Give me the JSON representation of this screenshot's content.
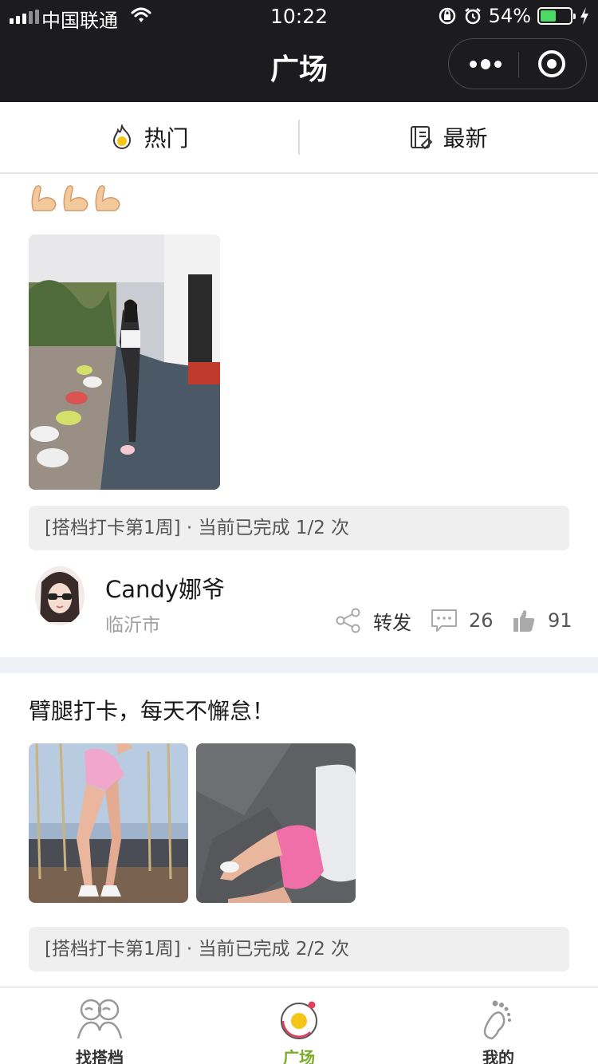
{
  "status_bar": {
    "carrier": "中国联通",
    "time": "10:22",
    "battery_percent": "54%",
    "battery_level": 0.54
  },
  "nav": {
    "title": "广场"
  },
  "tabs": [
    {
      "label": "热门",
      "icon": "fire-icon"
    },
    {
      "label": "最新",
      "icon": "notebook-icon"
    }
  ],
  "posts": [
    {
      "text_emoji": "💪💪💪",
      "checkin": "[搭档打卡第1周] · 当前已完成 1/2 次",
      "user": {
        "name": "Candy娜爷",
        "city": "临沂市"
      },
      "share_label": "转发",
      "comments": "26",
      "likes": "91"
    },
    {
      "text": "臂腿打卡，每天不懈怠！",
      "checkin": "[搭档打卡第1周] · 当前已完成 2/2 次"
    }
  ],
  "tabbar": [
    {
      "label": "找搭档",
      "icon": "partners-icon",
      "active": false
    },
    {
      "label": "广场",
      "icon": "plaza-icon",
      "active": true
    },
    {
      "label": "我的",
      "icon": "footprint-icon",
      "active": false
    }
  ],
  "colors": {
    "nav_bg": "#1c1c1e",
    "active_green": "#7aab27",
    "battery_green": "#4cd964",
    "plaza_yellow": "#f5c518",
    "plaza_ring": "#e0405e"
  }
}
